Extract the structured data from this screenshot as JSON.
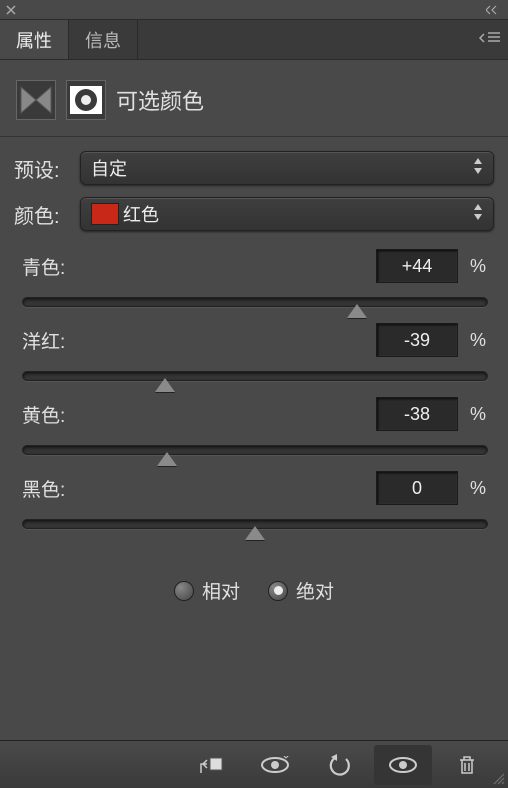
{
  "tabs": {
    "properties": "属性",
    "info": "信息"
  },
  "panel_title": "可选颜色",
  "preset": {
    "label": "预设:",
    "value": "自定"
  },
  "color": {
    "label": "颜色:",
    "value": "红色",
    "swatch": "#c82818"
  },
  "channels": {
    "cyan": {
      "label": "青色:",
      "value": "+44",
      "pct": 72
    },
    "magenta": {
      "label": "洋红:",
      "value": "-39",
      "pct": 30.5
    },
    "yellow": {
      "label": "黄色:",
      "value": "-38",
      "pct": 31
    },
    "black": {
      "label": "黑色:",
      "value": "0",
      "pct": 50
    }
  },
  "percent_sign": "%",
  "mode": {
    "relative": "相对",
    "absolute": "绝对",
    "selected": "absolute"
  }
}
